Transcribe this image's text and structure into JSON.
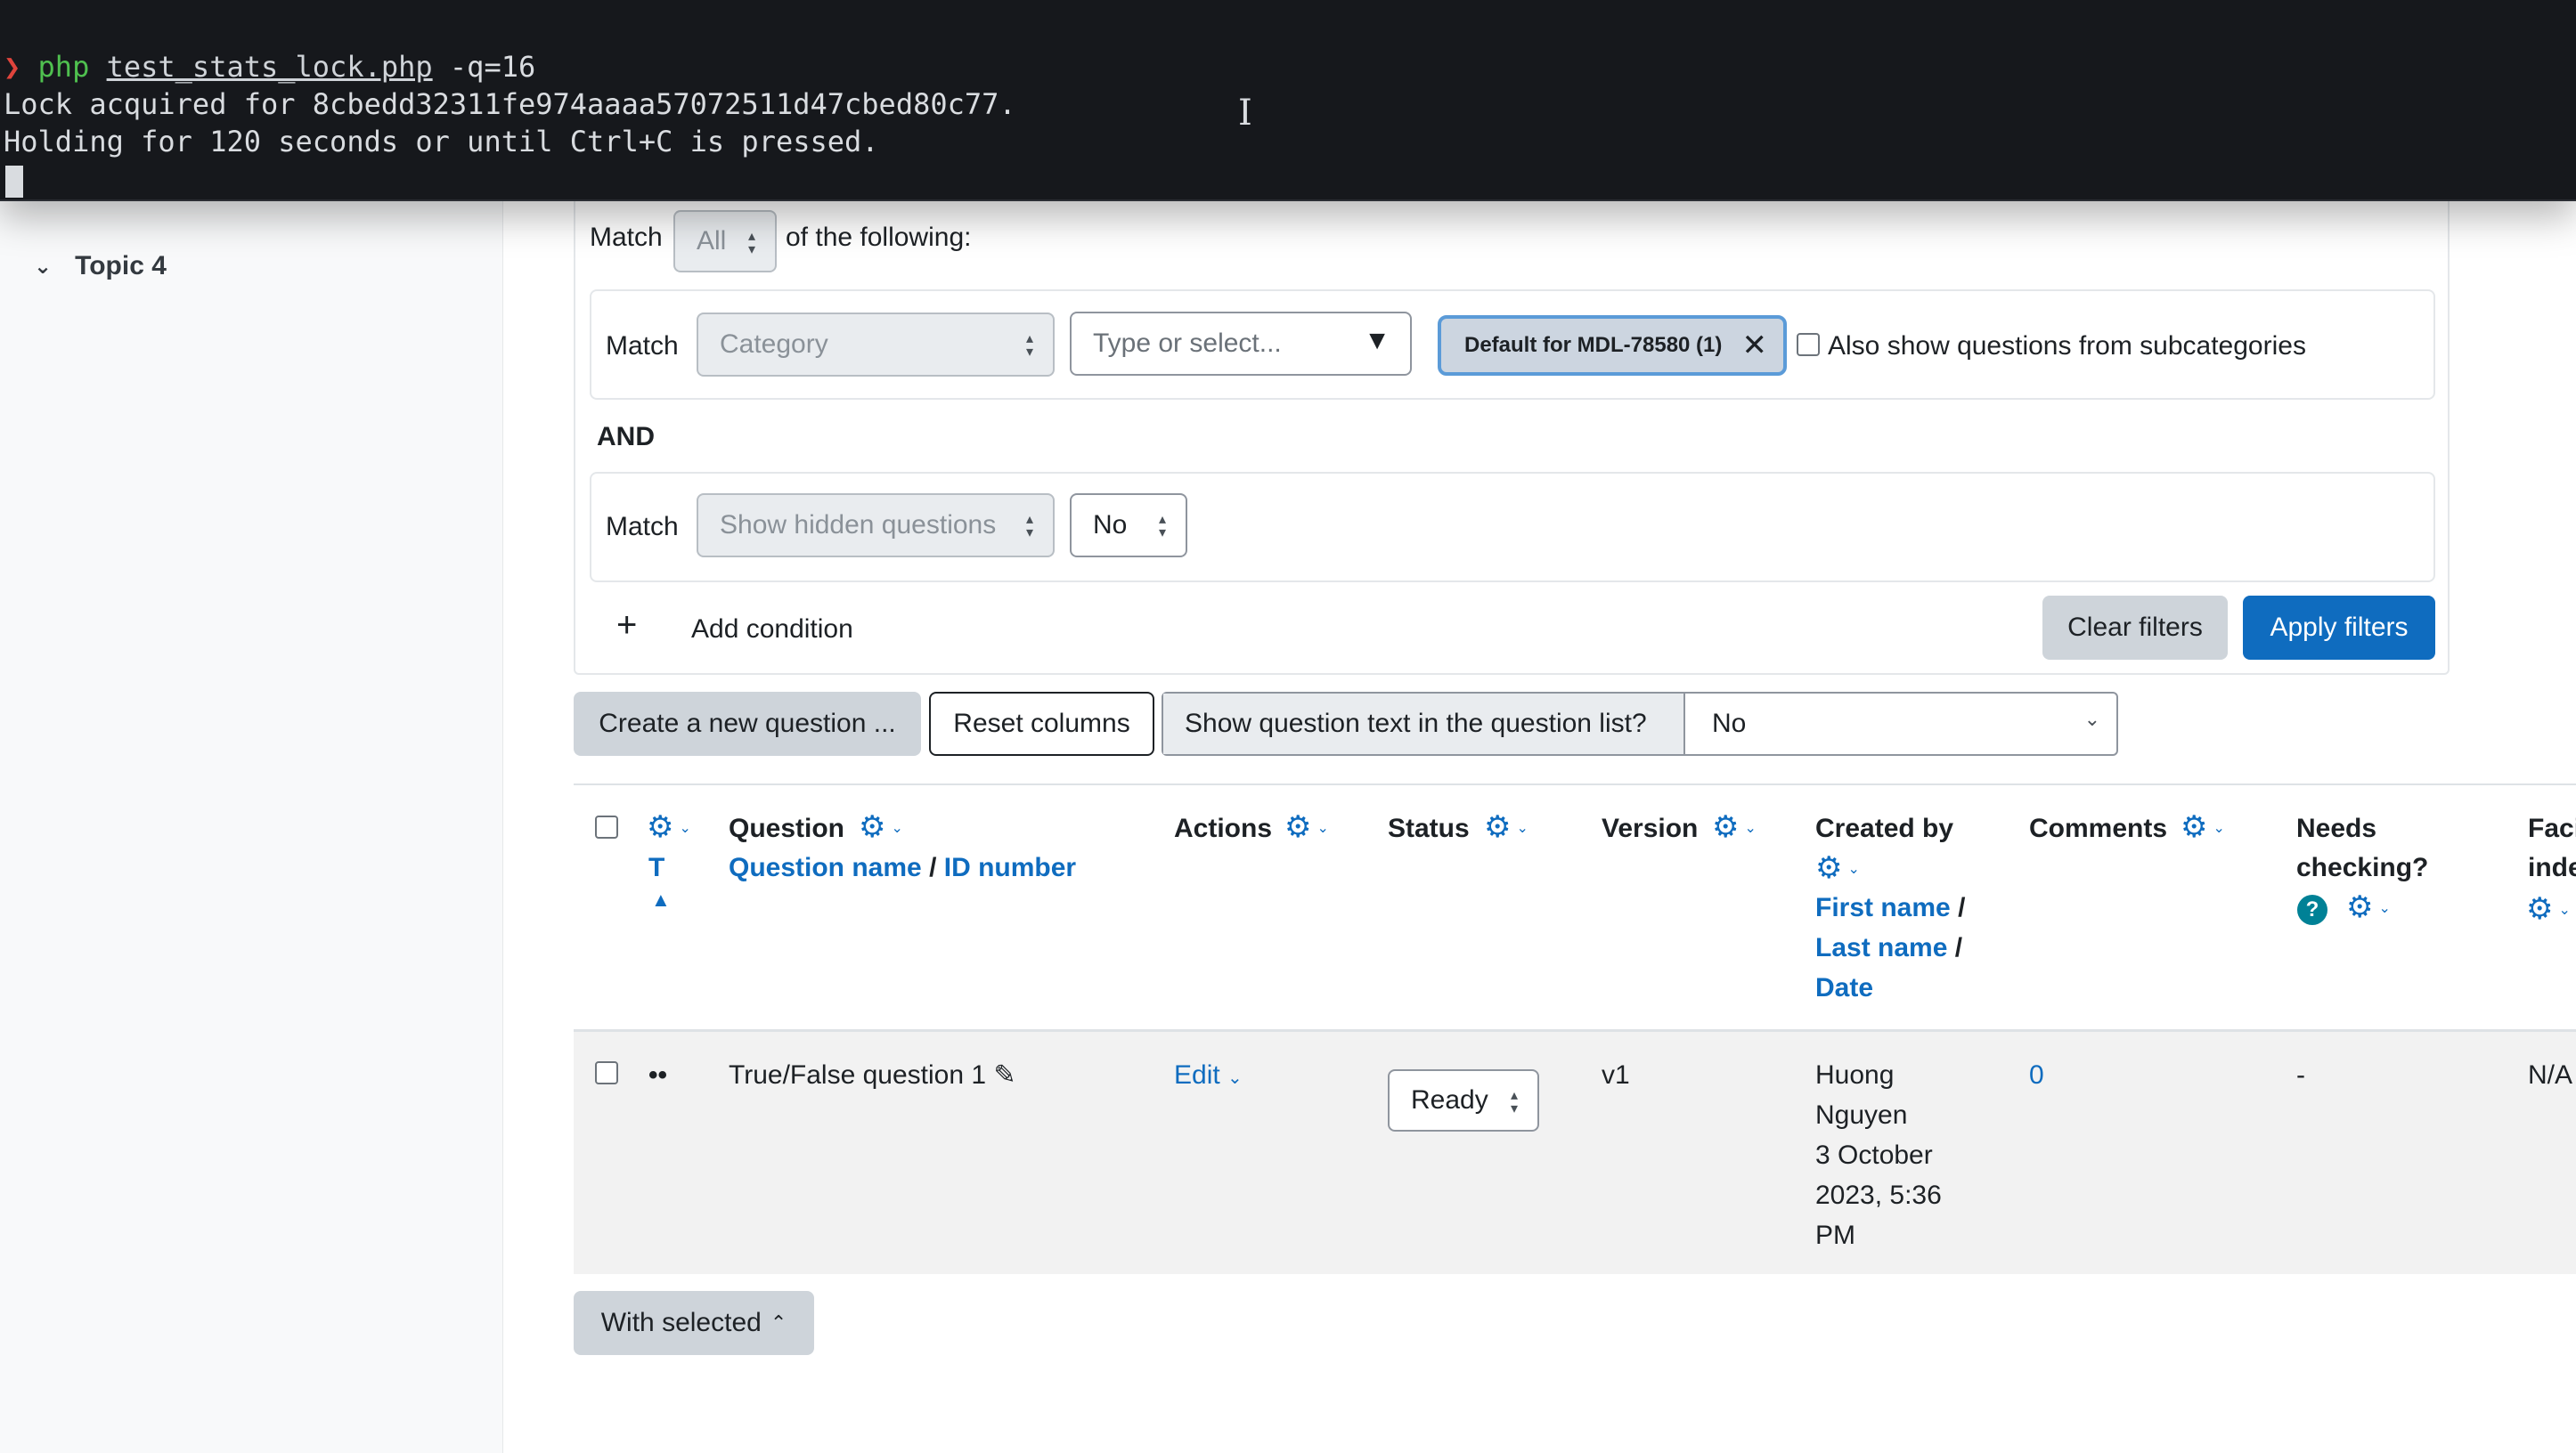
{
  "terminal": {
    "prompt_symbol": "❯",
    "command": "php",
    "file": "test_stats_lock.php",
    "args": " -q=16",
    "output_line_1": "Lock acquired for 8cbedd32311fe974aaaa57072511d47cbed80c77.",
    "output_line_2": "Holding for 120 seconds or until Ctrl+C is pressed."
  },
  "sidebar": {
    "topic_label": "Topic 4"
  },
  "filter": {
    "match_label": "Match",
    "match_value": "All",
    "of_following": "of the following:",
    "condition1": {
      "match_label": "Match",
      "type_value": "Category",
      "search_placeholder": "Type or select...",
      "badge_label": "Default for MDL-78580 (1)",
      "subcategories_label": "Also show questions from subcategories"
    },
    "and_label": "AND",
    "condition2": {
      "match_label": "Match",
      "type_value": "Show hidden questions",
      "value": "No"
    },
    "add_condition_label": "Add condition",
    "clear_filters_label": "Clear filters",
    "apply_filters_label": "Apply filters"
  },
  "toolbar": {
    "create_question_label": "Create a new question ...",
    "reset_columns_label": "Reset columns",
    "show_text_label": "Show question text in the question list?",
    "show_text_value": "No"
  },
  "table": {
    "headers": {
      "type_sort": "T",
      "question": "Question",
      "question_name": "Question name",
      "separator": "/",
      "id_number": "ID number",
      "actions": "Actions",
      "status": "Status",
      "version": "Version",
      "created_by": "Created by",
      "first_name": "First name",
      "last_name": "Last name",
      "date": "Date",
      "comments": "Comments",
      "needs_checking_1": "Needs",
      "needs_checking_2": "checking?",
      "facility_1": "Faci",
      "facility_2": "inde"
    },
    "row": {
      "type_icon": "••",
      "question_name": "True/False question 1",
      "edit_label": "Edit",
      "status_value": "Ready",
      "version": "v1",
      "creator_line1": "Huong",
      "creator_line2": "Nguyen",
      "date_line1": "3 October",
      "date_line2": "2023, 5:36",
      "date_line3": "PM",
      "comments": "0",
      "needs_checking": "-",
      "facility": "N/A"
    },
    "with_selected_label": "With selected"
  },
  "icons": {
    "gear": "gear-icon",
    "help": "?",
    "pencil": "✎"
  },
  "colors": {
    "primary": "#0f6cbf",
    "terminal_bg": "#16181c"
  }
}
